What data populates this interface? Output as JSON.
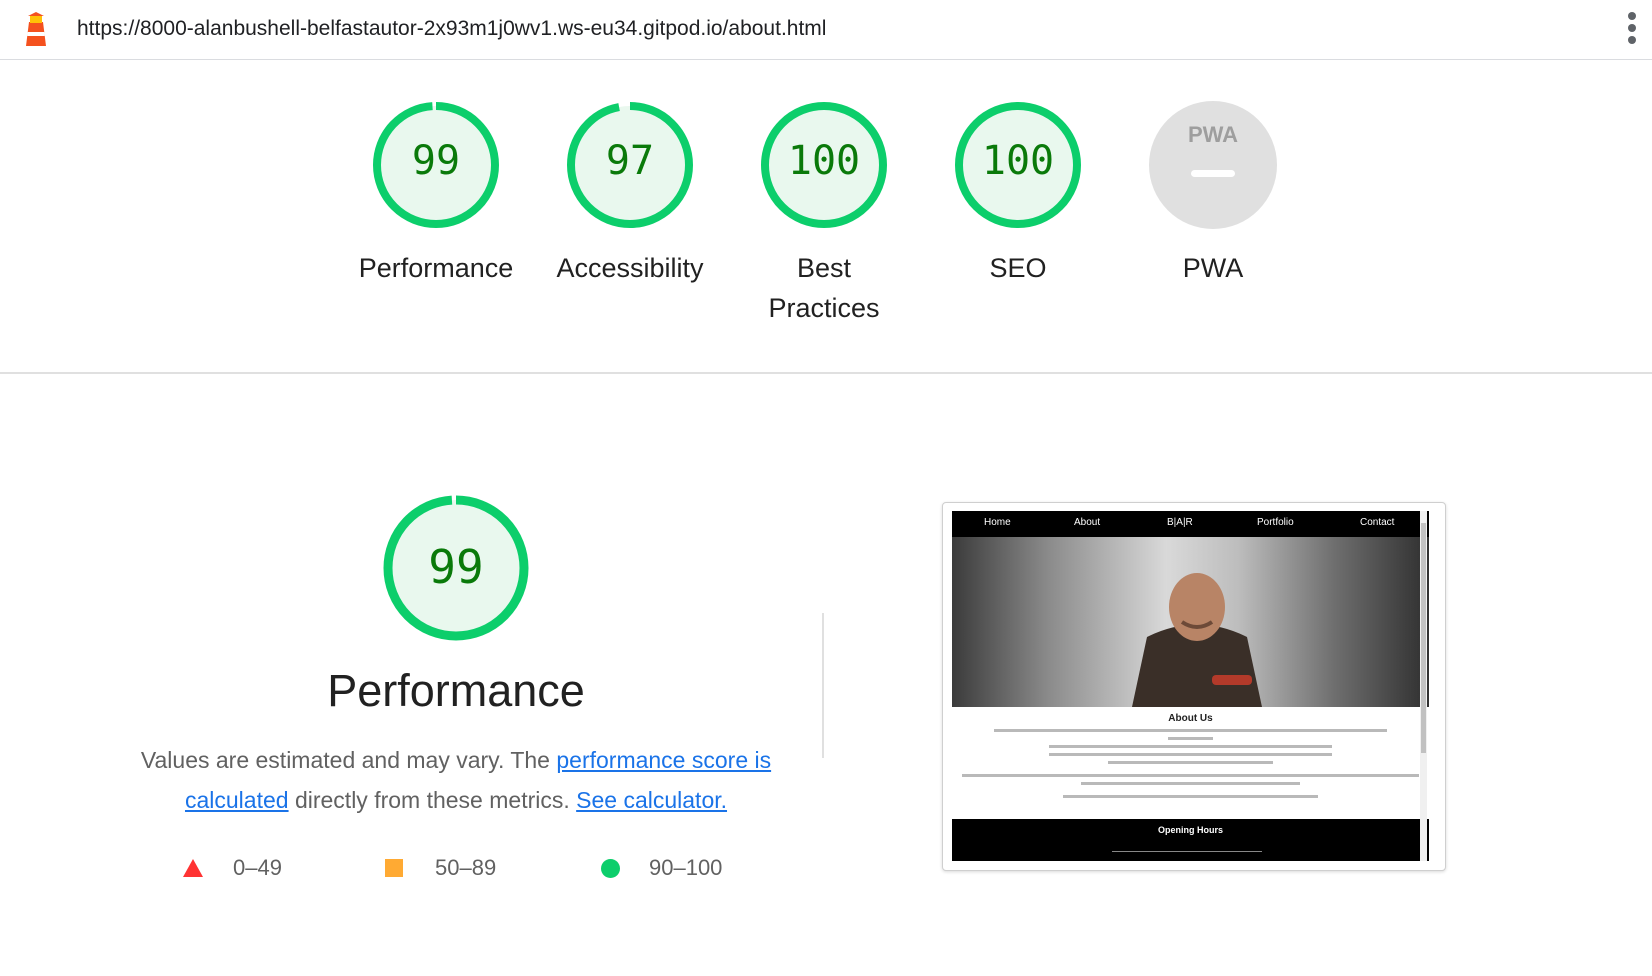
{
  "browser": {
    "url": "https://8000-alanbushell-belfastautor-2x93m1j0wv1.ws-eu34.gitpod.io/about.html",
    "logo_icon": "lighthouse-icon",
    "menu_icon": "kebab-menu-icon"
  },
  "gauges": [
    {
      "score": "99",
      "label": "Performance",
      "fraction": 0.99
    },
    {
      "score": "97",
      "label": "Accessibility",
      "fraction": 0.97
    },
    {
      "score": "100",
      "label": "Best Practices",
      "fraction": 1.0
    },
    {
      "score": "100",
      "label": "SEO",
      "fraction": 1.0
    },
    {
      "score": "PWA",
      "label": "PWA",
      "fraction": 0
    }
  ],
  "performance": {
    "score": "99",
    "fraction": 0.99,
    "title": "Performance",
    "desc_prefix": "Values are estimated and may vary. The ",
    "desc_link1": "performance score is calculated",
    "desc_middle": " directly from these metrics. ",
    "desc_link2": "See calculator.",
    "legend": [
      {
        "range": "0–49",
        "shape": "triangle",
        "color": "#ff3333"
      },
      {
        "range": "50–89",
        "shape": "square",
        "color": "#ffaa33"
      },
      {
        "range": "90–100",
        "shape": "circle",
        "color": "#0cce6b"
      }
    ]
  },
  "screenshot": {
    "nav": [
      "Home",
      "About",
      "B|A|R",
      "Portfolio",
      "Contact"
    ],
    "heading": "About Us",
    "footer_heading": "Opening Hours"
  },
  "colors": {
    "pass": "#0cce6b",
    "pass_text": "#0a7a0a",
    "pass_fill": "#e9f8ee",
    "link": "#1a73e8"
  }
}
